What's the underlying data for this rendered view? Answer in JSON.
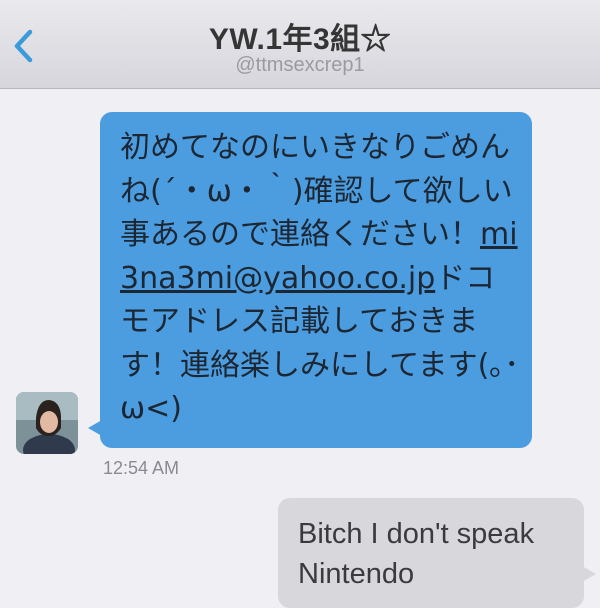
{
  "header": {
    "title": "YW.1年3組☆",
    "handle": "@ttmsexcrep1",
    "back_icon": "chevron-left-icon"
  },
  "conversation": {
    "incoming": {
      "text_before_email": "初めてなのにいきなりごめんね(´・ω・｀)確認して欲しい事あるので連絡ください！",
      "email": "mi3na3mi@yahoo.co.jp",
      "text_after_email": "ドコモアドレス記載しておきます！連絡楽しみにしてます(｡･ω<)",
      "timestamp": "12:54 AM",
      "bubble_color": "#4c9de0"
    },
    "outgoing": {
      "text": "Bitch I don't speak Nintendo",
      "bubble_color": "#d7d7dc"
    }
  }
}
